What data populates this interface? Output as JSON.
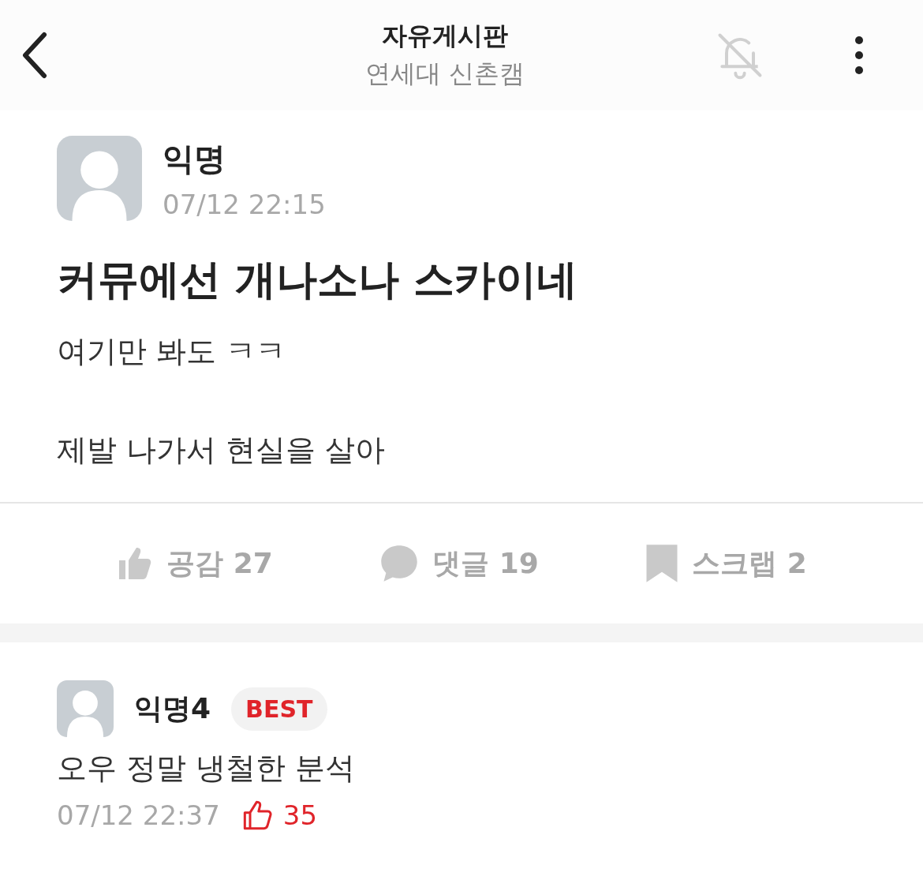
{
  "header": {
    "title": "자유게시판",
    "subtitle": "연세대 신촌캠"
  },
  "post": {
    "author": "익명",
    "time": "07/12 22:15",
    "title": "커뮤에선 개나소나 스카이네",
    "paragraphs": [
      "여기만 봐도 ㅋㅋ",
      "제발 나가서 현실을 살아"
    ]
  },
  "actions": [
    {
      "kind": "like",
      "label": "공감 27"
    },
    {
      "kind": "comment",
      "label": "댓글 19"
    },
    {
      "kind": "scrap",
      "label": "스크랩 2"
    }
  ],
  "comments": [
    {
      "author": "익명4",
      "badge": "BEST",
      "text": "오우 정말 냉철한 분석",
      "time": "07/12 22:37",
      "likes": "35"
    }
  ]
}
